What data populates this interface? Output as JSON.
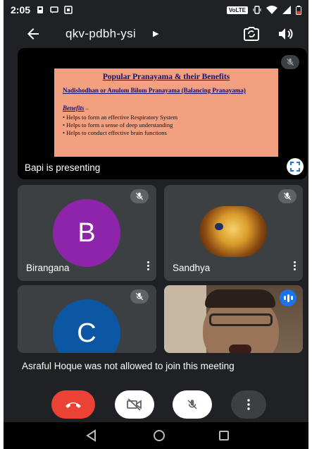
{
  "status_bar": {
    "time": "2:05",
    "network_label": "VoLTE"
  },
  "meeting": {
    "title": "qkv-pdbh-ysi"
  },
  "presentation": {
    "presenter_label": "Bapi is presenting",
    "slide": {
      "title": "Popular Pranayama & their Benefits",
      "subtitle": "Nadishodhan or Anulom Bilom Pranayama (Balancing Pranayama)",
      "benefits_heading": "Benefits",
      "benefits_suffix": " –",
      "benefits": [
        "• Helps to form an effective Respiratory System",
        "• Helps to form a sense of deep understanding",
        "• Helps to conduct effective brain functions"
      ]
    }
  },
  "participants": [
    {
      "name": "Birangana",
      "initial": "B",
      "avatar_color": "#8e24aa",
      "muted": true
    },
    {
      "name": "Sandhya",
      "initial": "",
      "avatar_type": "photo",
      "muted": true
    },
    {
      "name": "",
      "initial": "C",
      "avatar_color": "#0b57a4",
      "muted": true
    },
    {
      "name": "",
      "avatar_type": "video",
      "speaking": true
    }
  ],
  "notification": {
    "text": "Asraful Hoque was not allowed to join this meeting"
  },
  "controls": {
    "end_call_color": "#ea4335",
    "camera": "camera-off",
    "mic": "mic-off",
    "more": "more-options"
  },
  "colors": {
    "background": "#202124",
    "tile": "#3c4043",
    "accent": "#1a73e8"
  }
}
